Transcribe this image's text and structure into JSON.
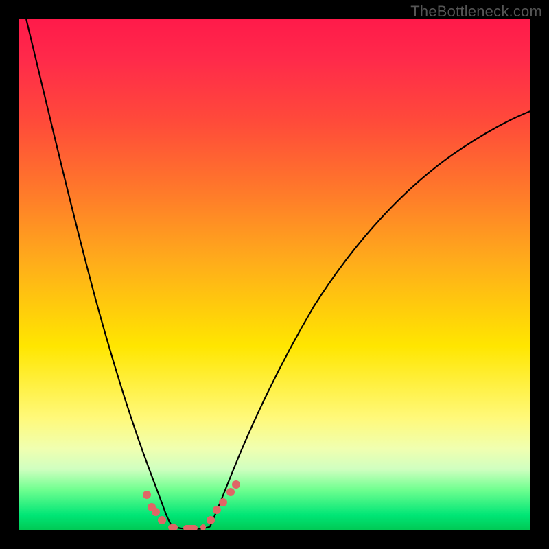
{
  "watermark": "TheBottleneck.com",
  "chart_data": {
    "type": "line",
    "title": "",
    "xlabel": "",
    "ylabel": "",
    "xlim": [
      0,
      1
    ],
    "ylim": [
      0,
      1
    ],
    "series": [
      {
        "name": "left-curve",
        "x": [
          0.015,
          0.05,
          0.1,
          0.15,
          0.2,
          0.235,
          0.255,
          0.27,
          0.28,
          0.29,
          0.3
        ],
        "values": [
          1.0,
          0.8,
          0.55,
          0.35,
          0.18,
          0.083,
          0.055,
          0.035,
          0.022,
          0.012,
          0.005
        ]
      },
      {
        "name": "right-curve",
        "x": [
          0.36,
          0.38,
          0.41,
          0.45,
          0.5,
          0.56,
          0.63,
          0.72,
          0.82,
          0.92,
          1.0
        ],
        "values": [
          0.005,
          0.028,
          0.07,
          0.14,
          0.23,
          0.34,
          0.46,
          0.59,
          0.7,
          0.78,
          0.82
        ]
      },
      {
        "name": "valley-floor",
        "x": [
          0.285,
          0.3,
          0.32,
          0.34,
          0.36,
          0.365
        ],
        "values": [
          0.005,
          0.003,
          0.002,
          0.002,
          0.003,
          0.005
        ]
      }
    ],
    "markers": {
      "left_dots": [
        {
          "x": 0.25,
          "y": 0.07
        },
        {
          "x": 0.26,
          "y": 0.045
        },
        {
          "x": 0.268,
          "y": 0.036
        },
        {
          "x": 0.28,
          "y": 0.02
        }
      ],
      "right_dots": [
        {
          "x": 0.375,
          "y": 0.02
        },
        {
          "x": 0.388,
          "y": 0.04
        },
        {
          "x": 0.4,
          "y": 0.055
        },
        {
          "x": 0.414,
          "y": 0.075
        },
        {
          "x": 0.425,
          "y": 0.09
        }
      ],
      "floor_segments": [
        {
          "x1": 0.292,
          "x2": 0.31,
          "y": 0.005
        },
        {
          "x1": 0.322,
          "x2": 0.35,
          "y": 0.004
        },
        {
          "x1": 0.355,
          "x2": 0.365,
          "y": 0.005
        }
      ]
    },
    "colors": {
      "curve": "#000000",
      "marker": "#e06666",
      "gradient_top": "#ff1a4a",
      "gradient_bottom": "#00c853"
    }
  }
}
